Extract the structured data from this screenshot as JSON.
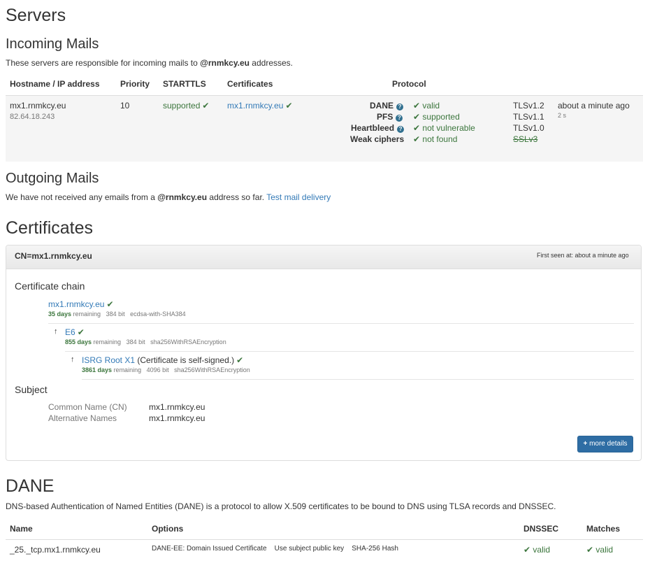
{
  "servers": {
    "title": "Servers",
    "incoming": {
      "title": "Incoming Mails",
      "desc_prefix": "These servers are responsible for incoming mails to ",
      "domain": "@rnmkcy.eu",
      "desc_suffix": " addresses.",
      "headers": {
        "hostname": "Hostname / IP address",
        "priority": "Priority",
        "starttls": "STARTTLS",
        "certificates": "Certificates",
        "protocol": "Protocol"
      },
      "row": {
        "hostname": "mx1.rnmkcy.eu",
        "ip": "82.64.18.243",
        "priority": "10",
        "starttls": "supported",
        "certificate": "mx1.rnmkcy.eu",
        "checks": [
          {
            "label": "DANE",
            "value": "valid"
          },
          {
            "label": "PFS",
            "value": "supported"
          },
          {
            "label": "Heartbleed",
            "value": "not vulnerable"
          },
          {
            "label": "Weak ciphers",
            "value": "not found"
          }
        ],
        "tls_versions": [
          "TLSv1.2",
          "TLSv1.1",
          "TLSv1.0",
          "SSLv3"
        ],
        "last_check": "about a minute ago",
        "duration": "2 s"
      }
    },
    "outgoing": {
      "title": "Outgoing Mails",
      "desc_prefix": "We have not received any emails from a ",
      "domain": "@rnmkcy.eu",
      "desc_suffix": " address so far.",
      "test_link": "Test mail delivery"
    }
  },
  "certificates": {
    "title": "Certificates",
    "panel": {
      "cn": "CN=mx1.rnmkcy.eu",
      "first_seen": "First seen at: about a minute ago",
      "chain_title": "Certificate chain",
      "chain": [
        {
          "name": "mx1.rnmkcy.eu",
          "days": "35 days",
          "remaining": "remaining",
          "bits": "384 bit",
          "algo": "ecdsa-with-SHA384"
        },
        {
          "name": "E6",
          "days": "855 days",
          "remaining": "remaining",
          "bits": "384 bit",
          "algo": "sha256WithRSAEncryption"
        },
        {
          "name": "ISRG Root X1",
          "note": "(Certificate is self-signed.)",
          "days": "3861 days",
          "remaining": "remaining",
          "bits": "4096 bit",
          "algo": "sha256WithRSAEncryption"
        }
      ],
      "subject_title": "Subject",
      "subject": [
        {
          "key": "Common Name (CN)",
          "value": "mx1.rnmkcy.eu"
        },
        {
          "key": "Alternative Names",
          "value": "mx1.rnmkcy.eu"
        }
      ],
      "more_details": "more details"
    }
  },
  "dane": {
    "title": "DANE",
    "desc": "DNS-based Authentication of Named Entities (DANE) is a protocol to allow X.509 certificates to be bound to DNS using TLSA records and DNSSEC.",
    "headers": {
      "name": "Name",
      "options": "Options",
      "dnssec": "DNSSEC",
      "matches": "Matches"
    },
    "row": {
      "name": "_25._tcp.mx1.rnmkcy.eu",
      "options": [
        "DANE-EE: Domain Issued Certificate",
        "Use subject public key",
        "SHA-256 Hash"
      ],
      "dnssec": "valid",
      "matches": "valid"
    }
  },
  "colors": {
    "link": "#337ab7",
    "success": "#3c763d",
    "info_icon": "#31708f",
    "button": "#2e6da4"
  }
}
